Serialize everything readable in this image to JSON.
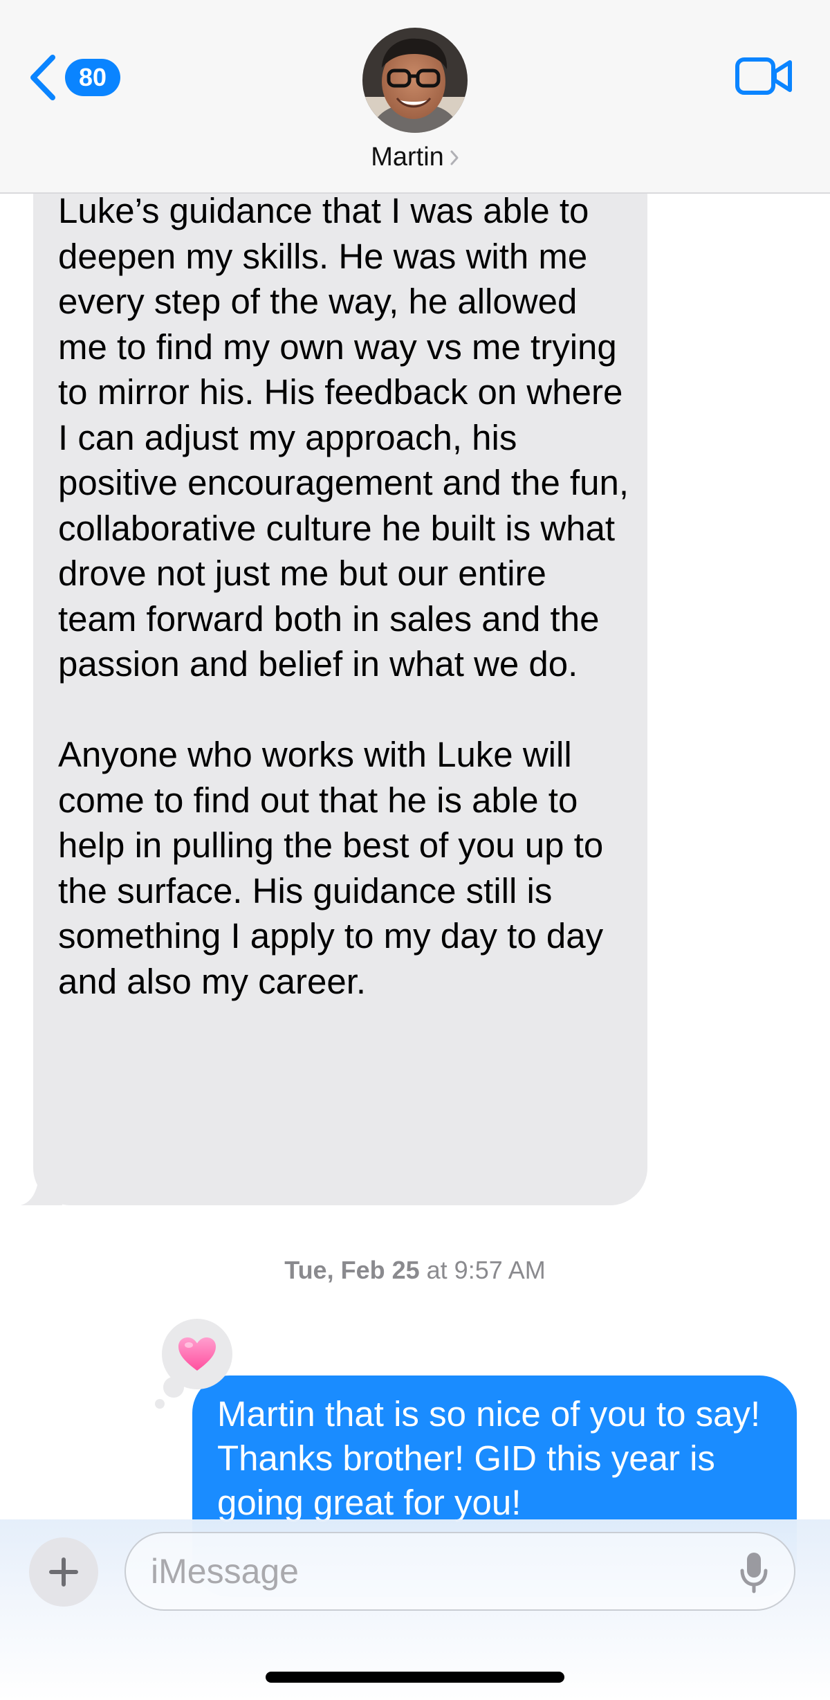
{
  "header": {
    "back_badge_count": "80",
    "contact_name": "Martin",
    "icons": {
      "back": "chevron-left-icon",
      "contact_disclosure": "chevron-right-icon",
      "facetime": "video-camera-icon"
    }
  },
  "conversation": {
    "incoming_message": {
      "paragraphs": [
        "Luke’s guidance that I was able to deepen my skills. He was with me every step of the way, he allowed me to find my own way vs me trying to mirror his. His feedback on where I can adjust my approach, his positive encouragement and the fun, collaborative culture he built is what drove not just me but our entire team forward both in sales and the passion and belief in what we do.",
        "Anyone who works with Luke will come to find out that he is able to help in pulling the best of you up to the surface. His guidance still is something I apply to my day to day and also my career."
      ]
    },
    "timestamp": {
      "day": "Tue, Feb 25",
      "time": " at 9:57 AM"
    },
    "outgoing_message": {
      "text": "Martin that is so nice of you to say! Thanks brother! GID this year is going great for you!",
      "tapback": "heart-icon"
    }
  },
  "composer": {
    "placeholder": "iMessage",
    "value": "",
    "icons": {
      "plus": "plus-icon",
      "mic": "microphone-icon"
    }
  },
  "colors": {
    "accent": "#0a84ff",
    "outgoing_bubble": "#1a8cff",
    "incoming_bubble": "#e9e9eb",
    "tapback_heart": "#ff6fb0"
  }
}
